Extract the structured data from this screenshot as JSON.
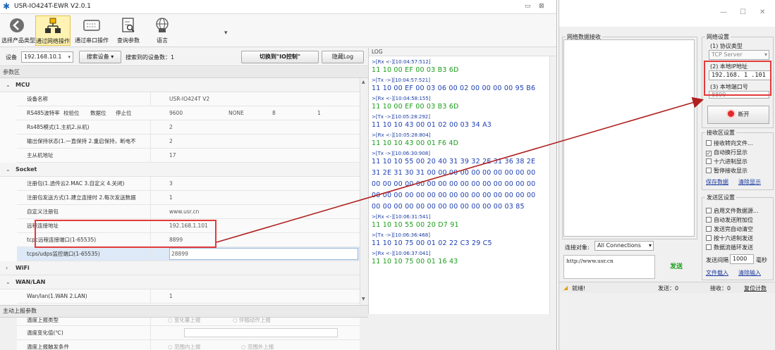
{
  "app": {
    "title": "USR-IO424T-EWR V2.0.1",
    "toolbar": [
      {
        "label": "选择产品类型",
        "icon": "circle-arrow-icon"
      },
      {
        "label": "通过网络操作",
        "icon": "network-icon",
        "active": true
      },
      {
        "label": "通过串口操作",
        "icon": "keyboard-icon"
      },
      {
        "label": "查询参数",
        "icon": "query-icon"
      },
      {
        "label": "语言",
        "icon": "globe-icon"
      }
    ],
    "devbar": {
      "device_label": "设备",
      "device_value": "192.168.10.1",
      "search_btn": "搜索设备",
      "found_text": "搜索到的设备数：1",
      "switch_btn": "切换到\"IO控制\"",
      "hide_log_btn": "隐藏Log"
    },
    "param_header": "参数区",
    "mcu": {
      "group": "MCU",
      "rows": [
        {
          "key": "设备名称",
          "value": "USR-IO424T V2"
        },
        {
          "key": "RS485波特率",
          "sub": [
            "校验位",
            "数据位",
            "停止位"
          ],
          "cells": [
            "9600",
            "NONE",
            "8",
            "1"
          ]
        },
        {
          "key": "Rs485模式(1.主机2.从机)",
          "value": "2"
        },
        {
          "key": "输出保持状态(1.一直保持 2.重启保持，断电不",
          "value": "2"
        },
        {
          "key": "主从机地址",
          "value": "17"
        }
      ]
    },
    "socket": {
      "group": "Socket",
      "rows": [
        {
          "key": "注册包(1.透传云2.MAC 3.自定义 4.关闭)",
          "value": "3"
        },
        {
          "key": "注册包发送方式(1.建立连接时 2.每次发送数据",
          "value": "1"
        },
        {
          "key": "自定义注册包",
          "value": "www.usr.cn"
        },
        {
          "key": "远程连接地址",
          "value": "192.168.1.101"
        },
        {
          "key": "tcpc远程连接端口(1-65535)",
          "value": "8899"
        },
        {
          "key": "tcps/udps监控端口(1-65535)",
          "value": "28899"
        }
      ]
    },
    "wifi": {
      "group": "WiFi"
    },
    "wanlan": {
      "group": "WAN/LAN",
      "rows": [
        {
          "key": "Wan/lan(1.WAN 2.LAN)",
          "value": "1"
        }
      ]
    },
    "active": {
      "header": "主动上报参数",
      "rows": [
        {
          "key": "温度上报类型",
          "opt1": "变化量上报",
          "opt2": "伴随动作上报"
        },
        {
          "key": "温度变化值(℃)"
        },
        {
          "key": "温度上报触发条件",
          "opt1": "范围内上报",
          "opt2": "范围外上报"
        }
      ]
    },
    "log": {
      "header": "LOG",
      "entries": [
        {
          "type": "meta",
          "text": ">[Rx <-][10:04:57:512]"
        },
        {
          "type": "rx",
          "text": "11 10 00 EF 00 03 B3 6D"
        },
        {
          "type": "meta",
          "text": ">[Tx ->][10:04:57:521]"
        },
        {
          "type": "tx",
          "text": "11 10 00 EF 00 03 06 00 02 00 00 00 00 95 B6"
        },
        {
          "type": "meta",
          "text": ">[Rx <-][10:04:58:155]"
        },
        {
          "type": "rx",
          "text": "11 10 00 EF 00 03 B3 6D"
        },
        {
          "type": "meta",
          "text": ">[Tx ->][10:05:28:292]"
        },
        {
          "type": "tx",
          "text": "11 10 10 43 00 01 02 00 03 34 A3"
        },
        {
          "type": "meta",
          "text": ">[Rx <-][10:05:28:804]"
        },
        {
          "type": "rx",
          "text": "11 10 10 43 00 01 F6 4D"
        },
        {
          "type": "meta",
          "text": ">[Tx ->][10:06:30:908]"
        },
        {
          "type": "tx",
          "text": "11 10 10 55 00 20 40 31 39 32 2E 31 36 38 2E"
        },
        {
          "type": "tx",
          "text": "31 2E 31 30 31 00 00 00 00 00 00 00 00 00 00"
        },
        {
          "type": "tx",
          "text": "00 00 00 00 00 00 00 00 00 00 00 00 00 00 00"
        },
        {
          "type": "tx",
          "text": "00 00 00 00 00 00 00 00 00 00 00 00 00 00 00"
        },
        {
          "type": "tx",
          "text": "00 00 00 00 00 00 00 00 00 00 00 00 03 85"
        },
        {
          "type": "meta",
          "text": ">[Rx <-][10:06:31:541]"
        },
        {
          "type": "rx",
          "text": "11 10 10 55 00 20 D7 91"
        },
        {
          "type": "meta",
          "text": ">[Tx ->][10:06:36:468]"
        },
        {
          "type": "tx",
          "text": "11 10 10 75 00 01 02 22 C3 29 C5"
        },
        {
          "type": "meta",
          "text": ">[Rx <-][10:06:37:041]"
        },
        {
          "type": "rx",
          "text": "11 10 10 75 00 01 16 43"
        }
      ]
    }
  },
  "net": {
    "recv_group": "网络数据接收",
    "settings_group": "网络设置",
    "protocol_label": "(1) 协议类型",
    "protocol_value": "TCP Server",
    "host_label": "(2) 本地IP地址",
    "host_value": "192.168. 1 .101",
    "port_label": "(3) 本地端口号",
    "port_value": "8899",
    "listen_btn": "断开",
    "recv_settings": "接收区设置",
    "recv_opts": [
      {
        "label": "接收转向文件...",
        "checked": false
      },
      {
        "label": "自动换行显示",
        "checked": true
      },
      {
        "label": "十六进制显示",
        "checked": false
      },
      {
        "label": "暂停接收显示",
        "checked": false
      }
    ],
    "recv_links": [
      "保存数据",
      "清除显示"
    ],
    "send_settings": "发送区设置",
    "send_opts": [
      {
        "label": "启用文件数据源...",
        "checked": false
      },
      {
        "label": "自动发送附加位",
        "checked": false
      },
      {
        "label": "发送完自动清空",
        "checked": false
      },
      {
        "label": "按十六进制发送",
        "checked": false
      },
      {
        "label": "数据流循环发送",
        "checked": false
      }
    ],
    "interval_label": "发送间隔",
    "interval_value": "1000",
    "interval_unit": "毫秒",
    "send_links": [
      "文件载入",
      "清除输入"
    ],
    "conn_label": "连接对象:",
    "conn_value": "All Connections",
    "send_text": "http://www.usr.cn",
    "send_btn": "发送",
    "status_ready": "就绪!",
    "status_send": "发送：0",
    "status_recv": "接收：0",
    "status_reset": "复位计数"
  },
  "colors": {
    "highlight": "#e23b3b",
    "rx_green": "#1a9d1a",
    "tx_blue": "#1c3fb0"
  }
}
